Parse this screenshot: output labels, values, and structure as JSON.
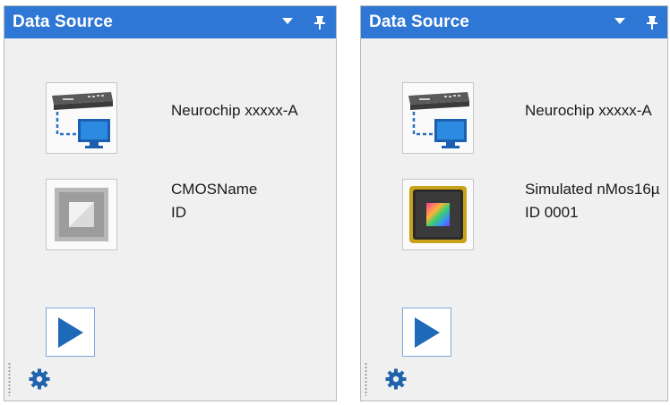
{
  "panels": [
    {
      "title": "Data Source",
      "device_icon": "network-computer-icon",
      "device_label": "Neurochip xxxxx-A",
      "chip_icon": "cmos-chip-placeholder-icon",
      "chip_name": "CMOSName",
      "chip_id": "ID"
    },
    {
      "title": "Data Source",
      "device_icon": "network-computer-icon",
      "device_label": "Neurochip xxxxx-A",
      "chip_icon": "cmos-chip-colored-icon",
      "chip_name": "Simulated nMos16µ",
      "chip_id": "ID 0001"
    }
  ],
  "colors": {
    "titlebar": "#2f77d4",
    "panel_bg": "#f0f0f0",
    "play": "#1e6ab8",
    "gear": "#1f62ad"
  }
}
